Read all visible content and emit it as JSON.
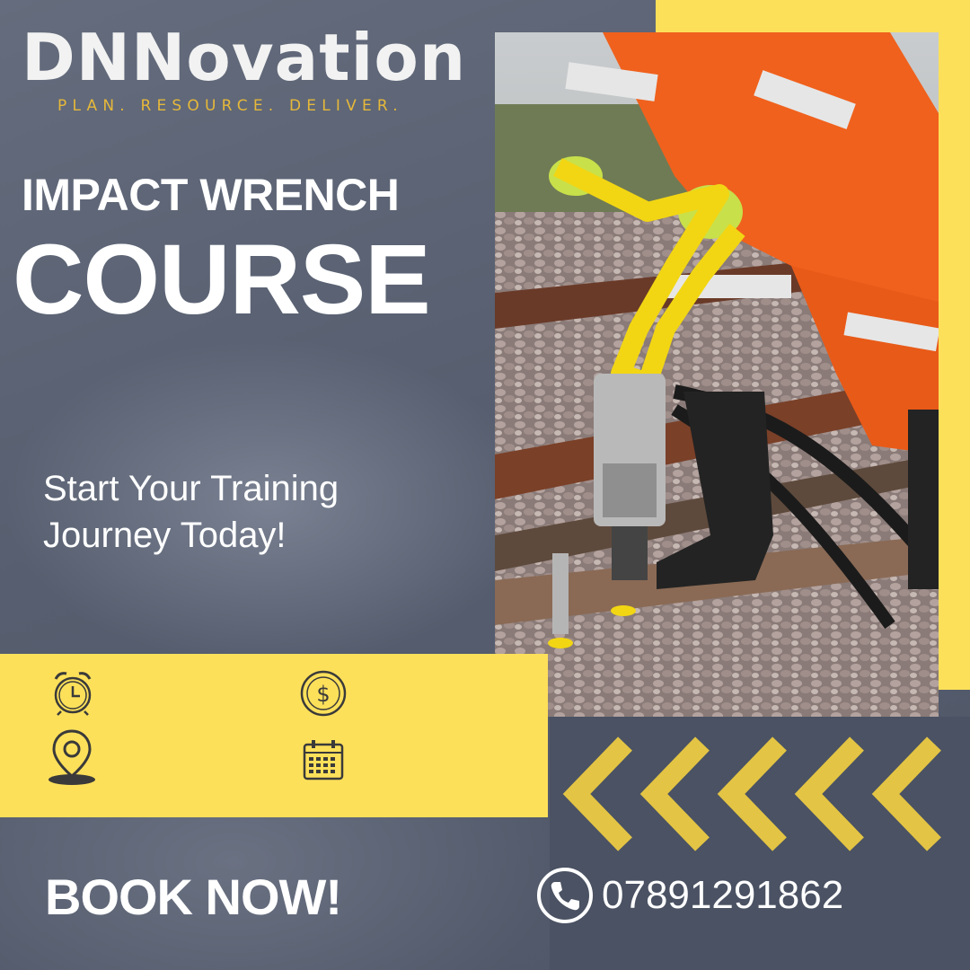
{
  "brand": {
    "name": "DNNovation",
    "tagline": "PLAN. RESOURCE. DELIVER."
  },
  "course": {
    "title_line1": "IMPACT WRENCH",
    "title_line2": "COURSE",
    "subtitle": "Start Your Training Journey Today!"
  },
  "info_icons": [
    "alarm-clock-icon",
    "dollar-coin-icon",
    "location-pin-icon",
    "calendar-icon"
  ],
  "cta": {
    "book_label": "BOOK NOW!",
    "phone": "07891291862"
  },
  "colors": {
    "accent_yellow": "#fde05a",
    "background_slate": "#5d6576",
    "dark_slate": "#4a5263",
    "chevron_gold": "#e3c444",
    "tagline_gold": "#e6b83a"
  }
}
